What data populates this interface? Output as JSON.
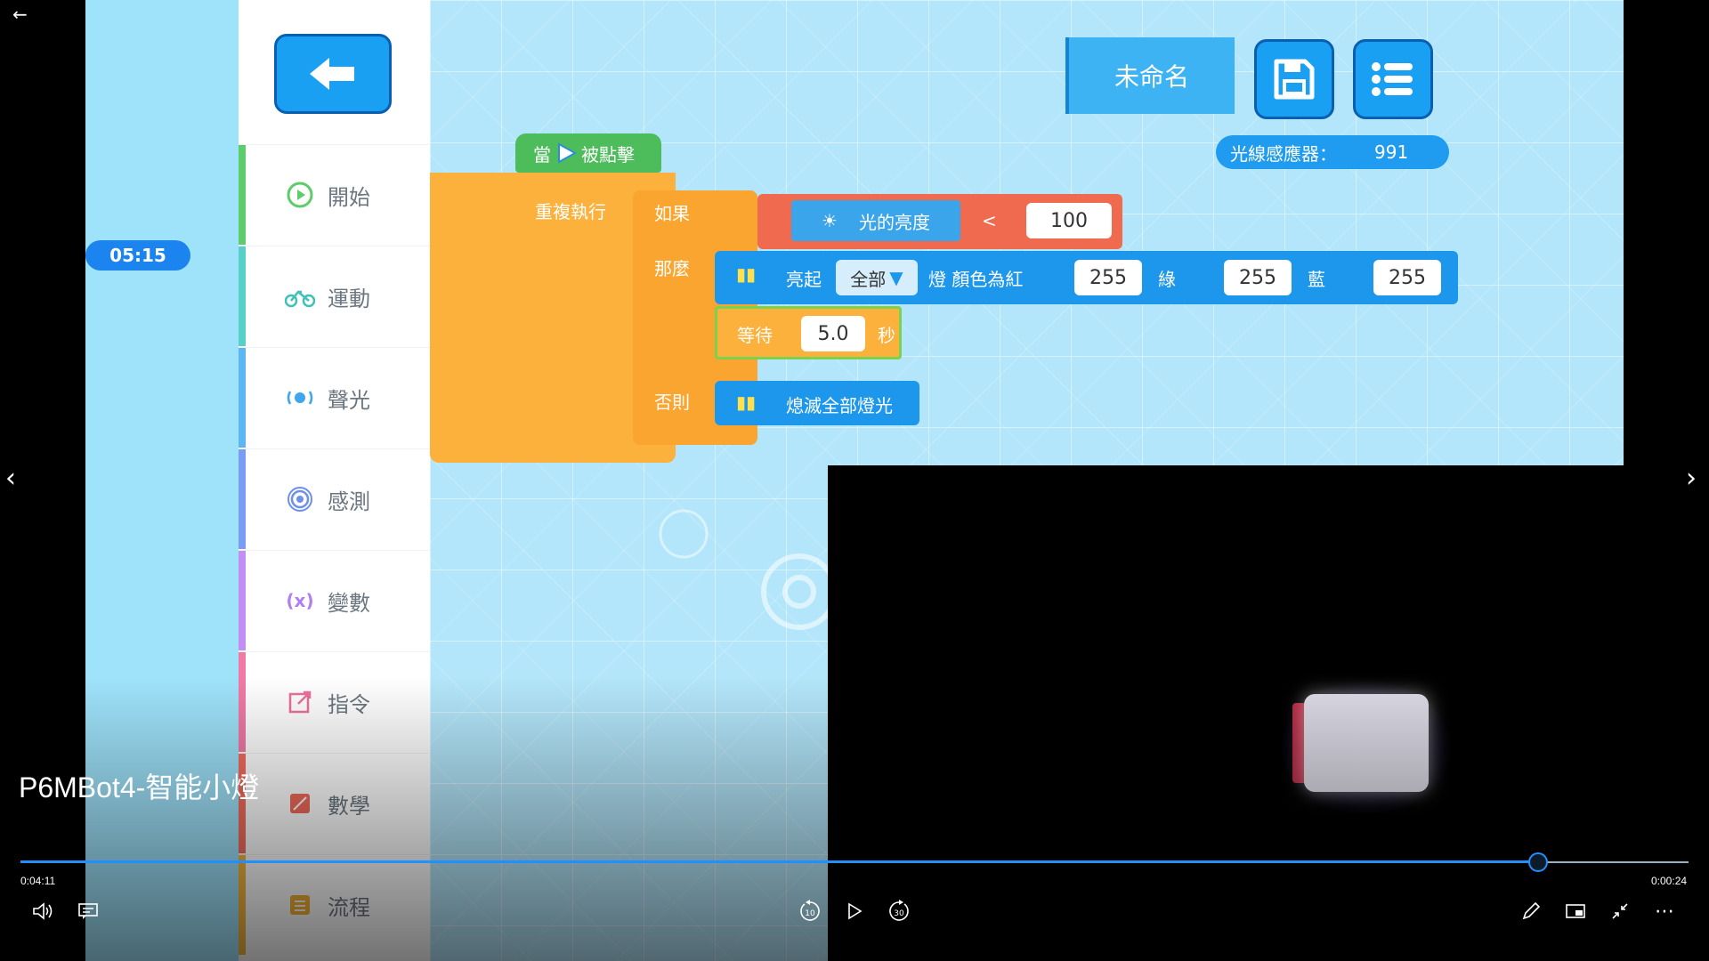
{
  "app": {
    "project_name": "未命名",
    "sensor_label": "光線感應器：",
    "sensor_value": "991",
    "categories": [
      {
        "label": "開始",
        "color": "#5ccd6a",
        "icon": "play-circle"
      },
      {
        "label": "運動",
        "color": "#58d0c8",
        "icon": "bike"
      },
      {
        "label": "聲光",
        "color": "#5cb6f2",
        "icon": "light-sound"
      },
      {
        "label": "感測",
        "color": "#7b9cf4",
        "icon": "sensor-wave"
      },
      {
        "label": "變數",
        "color": "#c38ff5",
        "icon": "variable"
      },
      {
        "label": "指令",
        "color": "#f07aa6",
        "icon": "command"
      },
      {
        "label": "數學",
        "color": "#f46d5e",
        "icon": "math"
      },
      {
        "label": "流程",
        "color": "#f6b63e",
        "icon": "flow"
      }
    ]
  },
  "blocks": {
    "hat": "當",
    "hat_suffix": "被點擊",
    "repeat": "重複執行",
    "if": "如果",
    "then": "那麼",
    "else": "否則",
    "light_brightness": "光的亮度",
    "lt": "<",
    "threshold": "100",
    "led_on": "亮起",
    "led_target": "全部",
    "led_color_prefix": "燈 顏色為紅",
    "red": "255",
    "green_label": "綠",
    "green": "255",
    "blue_label": "藍",
    "blue": "255",
    "wait": "等待",
    "wait_value": "5.0",
    "seconds": "秒",
    "off": "熄滅全部燈光"
  },
  "player": {
    "timer_badge": "05:15",
    "title": "P6MBot4-智能小燈",
    "elapsed": "0:04:11",
    "remaining": "0:00:24",
    "progress": 0.91,
    "skip_back": "10",
    "skip_forward": "30"
  }
}
